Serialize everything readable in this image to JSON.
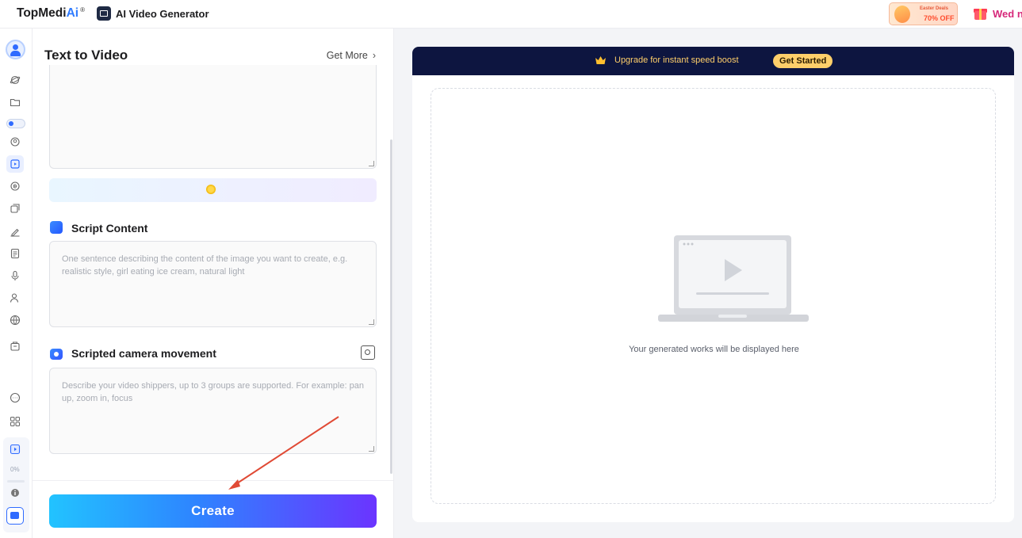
{
  "topbar": {
    "brand_main": "TopMedi",
    "brand_ai": "Ai",
    "brand_reg": "®",
    "app_title": "AI Video Generator",
    "deal_top": "Easter Deals",
    "deal_bottom": "70% OFF",
    "user_text": "Wed n"
  },
  "rail": {
    "items": [
      "avatar-icon",
      "planet-icon",
      "folder-icon",
      "toggle",
      "face-swap-icon",
      "video-icon",
      "audio-icon",
      "layers-icon",
      "brush-icon",
      "doc-icon",
      "mic-icon",
      "person-icon",
      "globe-icon",
      "box-icon",
      "chat-icon",
      "apps-icon",
      "video-active-icon",
      "info-icon",
      "card-icon"
    ],
    "progress_label": "0%",
    "progress_value": 0
  },
  "panel": {
    "title": "Text to Video",
    "get_more": "Get More",
    "chevron": "›",
    "script_title": "Script Content",
    "script_placeholder": "One sentence describing the content of the image you want to create, e.g. realistic style, girl eating ice cream, natural light",
    "camera_title": "Scripted camera movement",
    "camera_placeholder": "Describe your video shippers, up to 3 groups are supported. For example: pan up, zoom in, focus",
    "create_label": "Create"
  },
  "preview": {
    "banner_text": "Upgrade for instant speed boost",
    "banner_button": "Get Started",
    "empty_text": "Your generated works will be displayed here"
  },
  "colors": {
    "accent": "#2f6bff",
    "banner_bg": "#0d1540",
    "banner_gold": "#ffcf6a",
    "create_gradient_start": "#22c3ff",
    "create_gradient_end": "#6b34ff",
    "arrow": "#e04a35"
  }
}
